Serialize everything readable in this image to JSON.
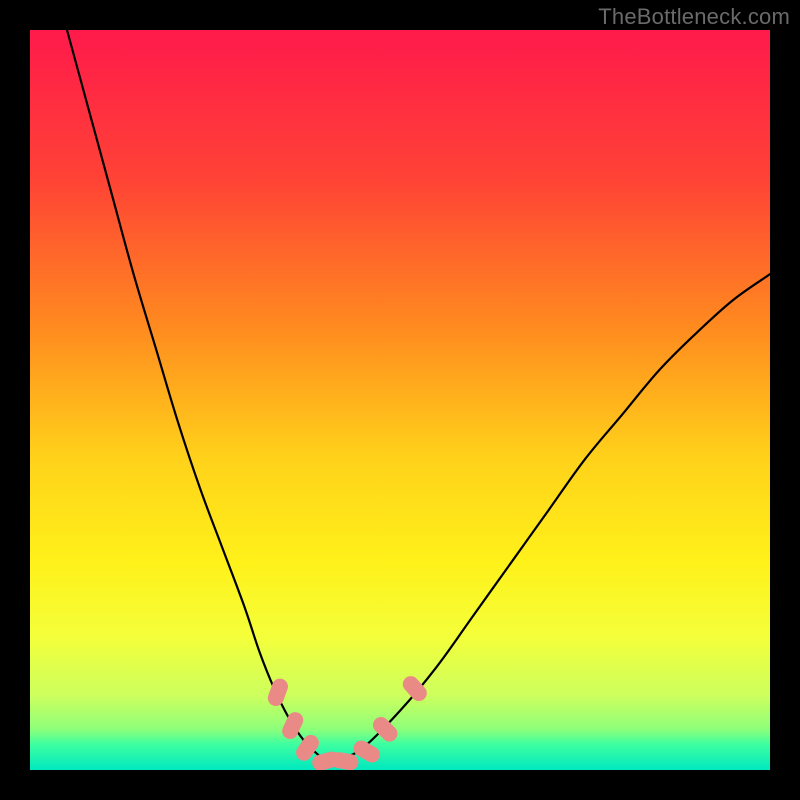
{
  "watermark": "TheBottleneck.com",
  "chart_data": {
    "type": "line",
    "title": "",
    "xlabel": "",
    "ylabel": "",
    "xlim": [
      0,
      100
    ],
    "ylim": [
      0,
      100
    ],
    "series": [
      {
        "name": "curve",
        "x": [
          5,
          8,
          11,
          14,
          17,
          20,
          23,
          26,
          29,
          31,
          33,
          35,
          37,
          39,
          40.5,
          42,
          45,
          50,
          55,
          60,
          65,
          70,
          75,
          80,
          85,
          90,
          95,
          100
        ],
        "y": [
          100,
          89,
          78,
          67,
          57,
          47,
          38,
          30,
          22,
          16,
          11,
          7,
          4,
          2,
          1,
          1.5,
          3,
          8,
          14,
          21,
          28,
          35,
          42,
          48,
          54,
          59,
          63.5,
          67
        ]
      }
    ],
    "markers": [
      {
        "x": 33.5,
        "y": 10.5,
        "angle": 70
      },
      {
        "x": 35.5,
        "y": 6.0,
        "angle": 65
      },
      {
        "x": 37.5,
        "y": 3.0,
        "angle": 55
      },
      {
        "x": 40.0,
        "y": 1.2,
        "angle": 15
      },
      {
        "x": 42.5,
        "y": 1.2,
        "angle": -10
      },
      {
        "x": 45.5,
        "y": 2.5,
        "angle": -30
      },
      {
        "x": 48.0,
        "y": 5.5,
        "angle": -45
      },
      {
        "x": 52.0,
        "y": 11.0,
        "angle": -48
      }
    ],
    "background": {
      "type": "vertical-gradient",
      "stops": [
        {
          "pos": 0.0,
          "color": "#ff1a4b"
        },
        {
          "pos": 0.2,
          "color": "#ff4236"
        },
        {
          "pos": 0.4,
          "color": "#ff8a1f"
        },
        {
          "pos": 0.58,
          "color": "#ffd21a"
        },
        {
          "pos": 0.72,
          "color": "#fff11a"
        },
        {
          "pos": 0.82,
          "color": "#f4ff3a"
        },
        {
          "pos": 0.9,
          "color": "#ccff5e"
        },
        {
          "pos": 0.945,
          "color": "#8dff7a"
        },
        {
          "pos": 0.965,
          "color": "#3effa0"
        },
        {
          "pos": 1.0,
          "color": "#00e8c0"
        }
      ]
    }
  }
}
